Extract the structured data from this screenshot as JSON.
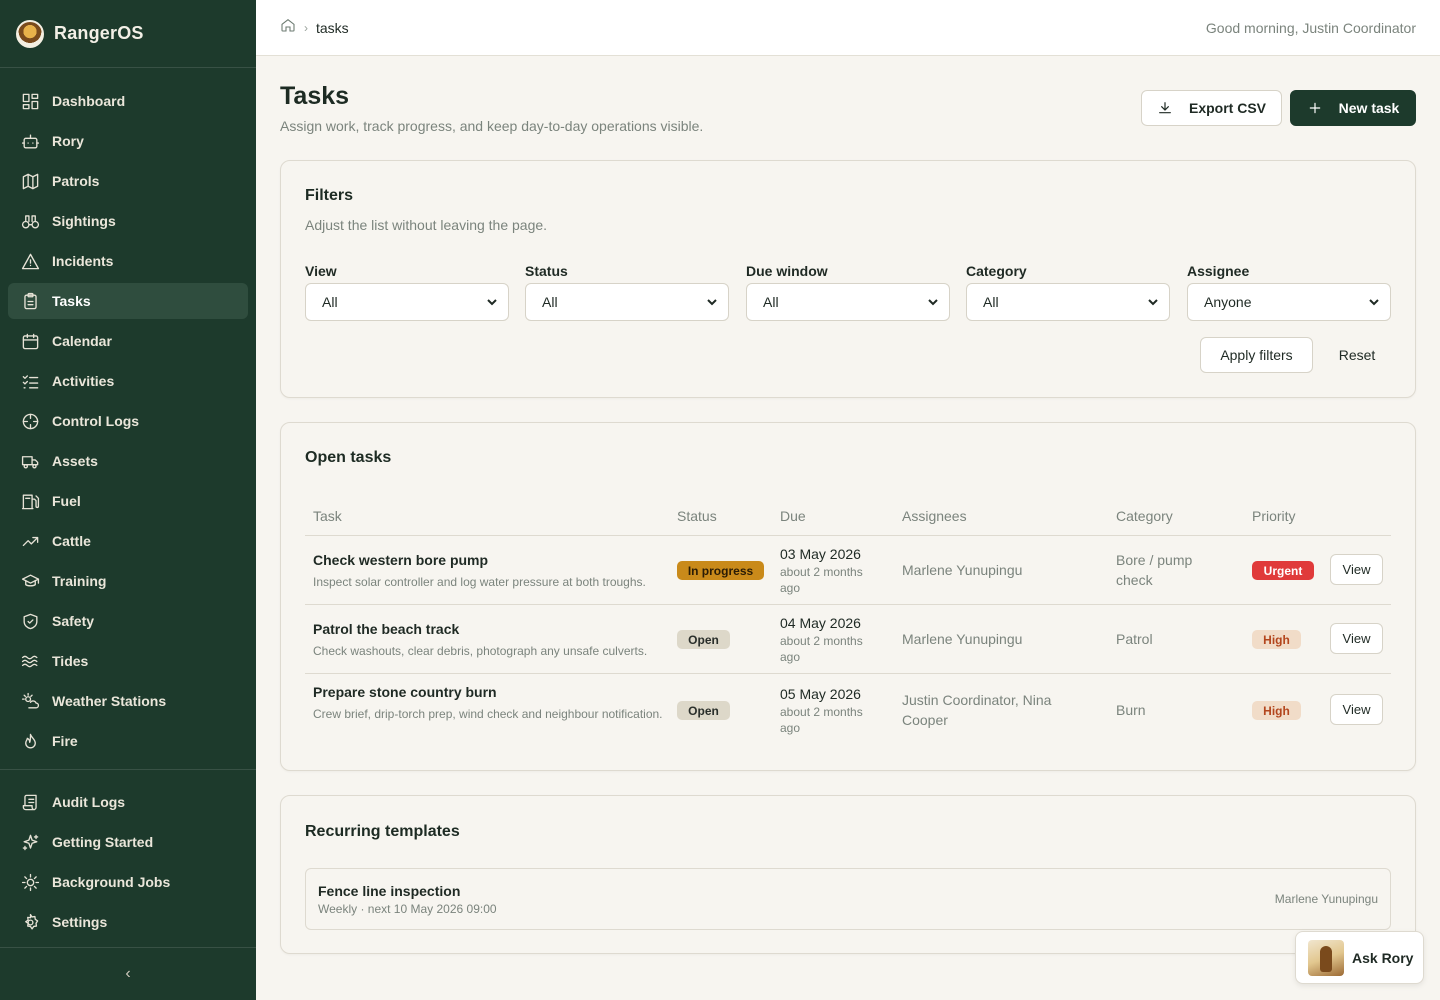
{
  "app": {
    "name": "RangerOS"
  },
  "sidebar": {
    "items": [
      {
        "label": "Dashboard",
        "icon": "dashboard-icon"
      },
      {
        "label": "Rory",
        "icon": "bot-icon"
      },
      {
        "label": "Patrols",
        "icon": "map-icon"
      },
      {
        "label": "Sightings",
        "icon": "binoculars-icon"
      },
      {
        "label": "Incidents",
        "icon": "warning-icon"
      },
      {
        "label": "Tasks",
        "icon": "clipboard-icon",
        "active": true
      },
      {
        "label": "Calendar",
        "icon": "calendar-icon"
      },
      {
        "label": "Activities",
        "icon": "list-check-icon"
      },
      {
        "label": "Control Logs",
        "icon": "crosshair-icon"
      },
      {
        "label": "Assets",
        "icon": "truck-icon"
      },
      {
        "label": "Fuel",
        "icon": "fuel-icon"
      },
      {
        "label": "Cattle",
        "icon": "trend-icon"
      },
      {
        "label": "Training",
        "icon": "graduation-cap-icon"
      },
      {
        "label": "Safety",
        "icon": "shield-icon"
      },
      {
        "label": "Tides",
        "icon": "waves-icon"
      },
      {
        "label": "Weather Stations",
        "icon": "sun-cloud-icon"
      },
      {
        "label": "Fire",
        "icon": "flame-icon"
      }
    ],
    "secondary": [
      {
        "label": "Audit Logs",
        "icon": "scroll-icon"
      },
      {
        "label": "Getting Started",
        "icon": "sparkles-icon"
      },
      {
        "label": "Background Jobs",
        "icon": "cog-icon"
      },
      {
        "label": "Settings",
        "icon": "settings-icon"
      }
    ],
    "collapse_glyph": "‹"
  },
  "topbar": {
    "breadcrumb_current": "tasks",
    "breadcrumb_sep": "›",
    "greeting": "Good morning, Justin Coordinator"
  },
  "page": {
    "title": "Tasks",
    "subtitle": "Assign work, track progress, and keep day-to-day operations visible.",
    "export_label": "Export CSV",
    "new_label": "New task"
  },
  "filters": {
    "title": "Filters",
    "subtitle": "Adjust the list without leaving the page.",
    "fields": [
      {
        "label": "View",
        "value": "All"
      },
      {
        "label": "Status",
        "value": "All"
      },
      {
        "label": "Due window",
        "value": "All"
      },
      {
        "label": "Category",
        "value": "All"
      },
      {
        "label": "Assignee",
        "value": "Anyone"
      }
    ],
    "apply_label": "Apply filters",
    "reset_label": "Reset"
  },
  "open_tasks": {
    "title": "Open tasks",
    "columns": [
      "Task",
      "Status",
      "Due",
      "Assignees",
      "Category",
      "Priority"
    ],
    "rows": [
      {
        "name": "Check western bore pump",
        "desc": "Inspect solar controller and log water pressure at both troughs.",
        "status": "In progress",
        "due": "03 May 2026",
        "due_rel": "about 2 months ago",
        "assignees": "Marlene Yunupingu",
        "category": "Bore / pump check",
        "priority": "Urgent",
        "action": "View"
      },
      {
        "name": "Patrol the beach track",
        "desc": "Check washouts, clear debris, photograph any unsafe culverts.",
        "status": "Open",
        "due": "04 May 2026",
        "due_rel": "about 2 months ago",
        "assignees": "Marlene Yunupingu",
        "category": "Patrol",
        "priority": "High",
        "action": "View"
      },
      {
        "name": "Prepare stone country burn",
        "desc": "Crew brief, drip-torch prep, wind check and neighbour notification.",
        "status": "Open",
        "due": "05 May 2026",
        "due_rel": "about 2 months ago",
        "assignees": "Justin Coordinator, Nina Cooper",
        "category": "Burn",
        "priority": "High",
        "action": "View"
      }
    ]
  },
  "recurring": {
    "title": "Recurring templates",
    "items": [
      {
        "name": "Fence line inspection",
        "schedule": "Weekly · next 10 May 2026 09:00",
        "owner": "Marlene Yunupingu"
      }
    ]
  },
  "assistant": {
    "label": "Ask Rory"
  },
  "colors": {
    "sidebar_bg": "#1d3a2c",
    "primary": "#1d3a2c",
    "in_progress": "#c98a1a",
    "urgent": "#e03a3a",
    "high_bg": "#f1dcc8",
    "high_text": "#b3461d"
  }
}
